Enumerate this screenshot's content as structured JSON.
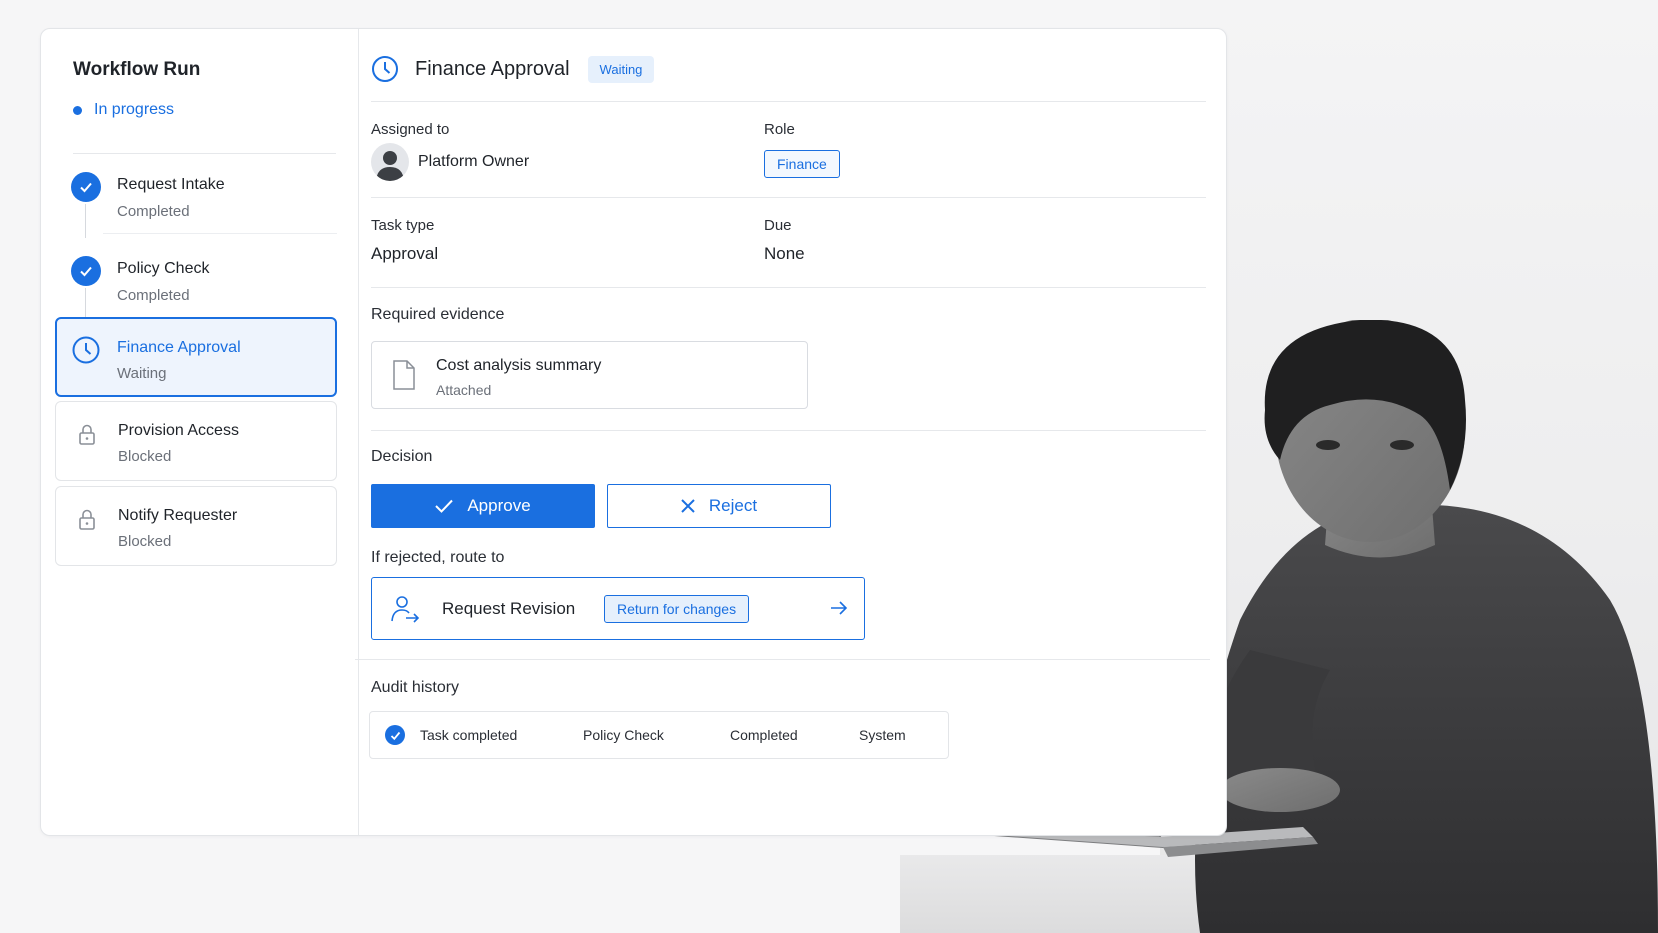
{
  "sidebar": {
    "title": "Workflow Run",
    "status": "In progress",
    "steps": [
      {
        "title": "Request Intake",
        "status": "Completed",
        "icon": "check-circle-icon"
      },
      {
        "title": "Policy Check",
        "status": "Completed",
        "icon": "check-circle-icon"
      },
      {
        "title": "Finance Approval",
        "status": "Waiting",
        "icon": "clock-icon"
      },
      {
        "title": "Provision Access",
        "status": "Blocked",
        "icon": "lock-icon"
      },
      {
        "title": "Notify Requester",
        "status": "Blocked",
        "icon": "lock-icon"
      }
    ]
  },
  "task": {
    "title": "Finance Approval",
    "status_badge": "Waiting",
    "assigned_label": "Assigned to",
    "assignee": "Platform Owner",
    "role_label": "Role",
    "role": "Finance",
    "type_label": "Task type",
    "type": "Approval",
    "due_label": "Due",
    "due": "None"
  },
  "evidence": {
    "heading": "Required evidence",
    "item_title": "Cost analysis summary",
    "item_status": "Attached"
  },
  "decision": {
    "heading": "Decision",
    "approve_label": "Approve",
    "reject_label": "Reject",
    "route_heading": "If rejected, route to",
    "route_target": "Request Revision",
    "route_badge": "Return for changes"
  },
  "audit": {
    "heading": "Audit history",
    "rows": [
      {
        "event": "Task completed",
        "step": "Policy Check",
        "status": "Completed",
        "actor": "System"
      }
    ]
  },
  "colors": {
    "accent": "#1a6fe0",
    "accent_light": "#e6f0fc",
    "muted_text": "#6b7079"
  }
}
